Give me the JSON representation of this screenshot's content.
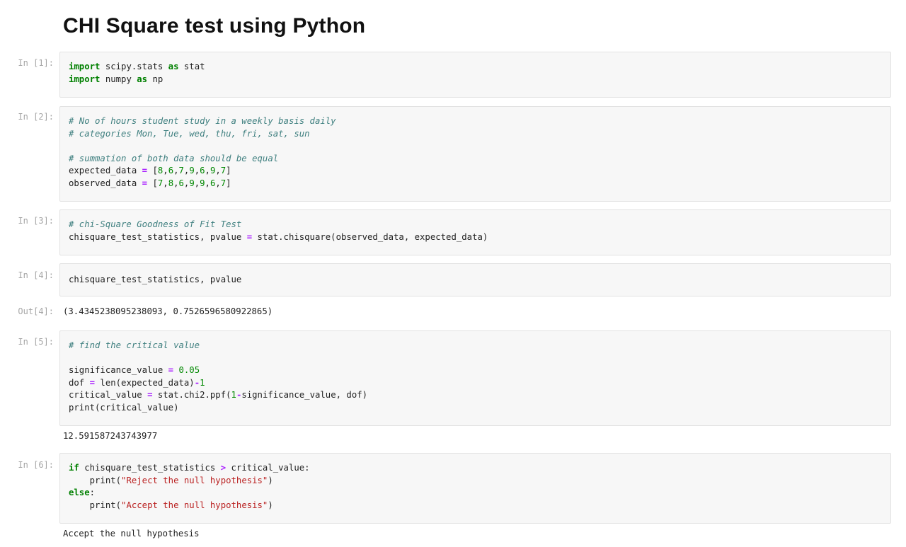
{
  "page": {
    "title": "CHI Square test using Python"
  },
  "cells": [
    {
      "prompt": "In [1]:",
      "lines": [
        {
          "kw1": "import",
          "t1": " scipy.stats ",
          "kw2": "as",
          "t2": " stat"
        },
        {
          "kw1": "import",
          "t1": " numpy ",
          "kw2": "as",
          "t2": " np"
        }
      ]
    },
    {
      "prompt": "In [2]:",
      "comment1": "# No of hours student study in a weekly basis daily",
      "comment2": "# categories Mon, Tue, wed, thu, fri, sat, sun",
      "comment3": "# summation of both data should be equal",
      "expected_name": "expected_data",
      "expected_values": [
        "8",
        "6",
        "7",
        "9",
        "6",
        "9",
        "7"
      ],
      "observed_name": "observed_data",
      "observed_values": [
        "7",
        "8",
        "6",
        "9",
        "9",
        "6",
        "7"
      ]
    },
    {
      "prompt": "In [3]:",
      "comment": "# chi-Square Goodness of Fit Test",
      "lhs": "chisquare_test_statistics, pvalue ",
      "rhs": " stat.chisquare(observed_data, expected_data)"
    },
    {
      "prompt": "In [4]:",
      "code": "chisquare_test_statistics, pvalue",
      "out_prompt": "Out[4]:",
      "output": "(3.4345238095238093, 0.7526596580922865)"
    },
    {
      "prompt": "In [5]:",
      "comment": "# find the critical value",
      "sig_name": "significance_value ",
      "sig_value": "0.05",
      "dof_lhs": "dof ",
      "dof_mid": " len(expected_data)",
      "dof_num": "1",
      "crit_lhs": "critical_value ",
      "crit_mid": " stat.chi2.ppf(",
      "crit_num": "1",
      "crit_end": "significance_value, dof)",
      "print_line": "print(critical_value)",
      "output": "12.591587243743977"
    },
    {
      "prompt": "In [6]:",
      "if_kw": "if",
      "if_lhs": " chisquare_test_statistics ",
      "if_op": ">",
      "if_rhs": " critical_value:",
      "print_open": "    print(",
      "reject_str": "\"Reject the null hypothesis\"",
      "print_close": ")",
      "else_kw": "else",
      "else_colon": ":",
      "accept_str": "\"Accept the null hypothesis\"",
      "output": "Accept the null hypothesis"
    }
  ],
  "syntax": {
    "assign_op": "=",
    "minus_op": "-",
    "lbracket": "[",
    "rbracket": "]",
    "comma": ","
  },
  "colors": {
    "keyword": "#008000",
    "comment": "#408080",
    "number": "#008800",
    "operator": "#aa22ff",
    "string": "#ba2121",
    "prompt": "#a6a6a6",
    "cell_bg": "#f7f7f7"
  }
}
